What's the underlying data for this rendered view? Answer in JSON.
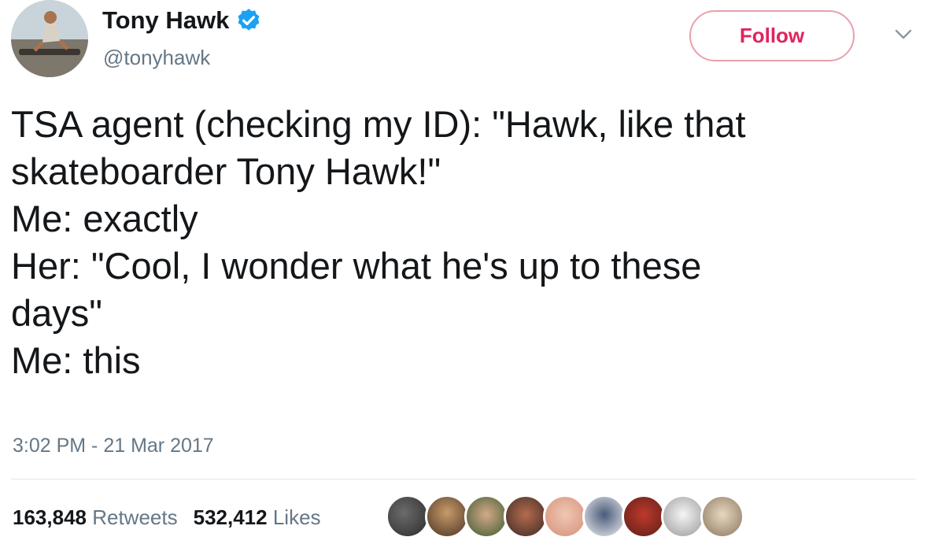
{
  "author": {
    "name": "Tony Hawk",
    "handle": "@tonyhawk",
    "verified_icon": "verified-badge-icon",
    "avatar_icon": "profile-avatar"
  },
  "follow_button": {
    "label": "Follow"
  },
  "menu_icon": "chevron-down-icon",
  "tweet": {
    "lines": [
      "TSA agent (checking my ID): \"Hawk, like that",
      "skateboarder Tony Hawk!\"",
      "Me: exactly",
      "Her: \"Cool, I wonder what he's up to these",
      "days\"",
      "Me: this"
    ],
    "timestamp": "3:02 PM - 21 Mar 2017"
  },
  "stats": {
    "retweets_count": "163,848",
    "retweets_label": "Retweets",
    "likes_count": "532,412",
    "likes_label": "Likes"
  },
  "colors": {
    "follow_accent": "#e0245e",
    "verified": "#1da1f2",
    "secondary_text": "#657786"
  }
}
